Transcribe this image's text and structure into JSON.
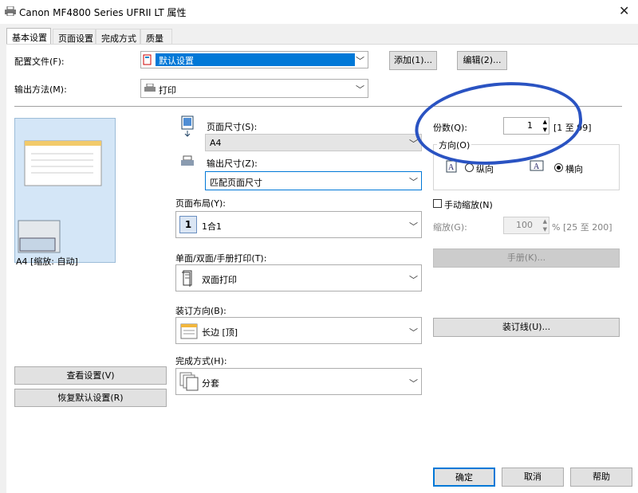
{
  "window": {
    "title": "Canon MF4800 Series UFRII LT 属性",
    "close": "✕"
  },
  "tabs": [
    "基本设置",
    "页面设置",
    "完成方式",
    "质量"
  ],
  "profile": {
    "label": "配置文件(F):",
    "value": "默认设置",
    "add": "添加(1)...",
    "edit": "编辑(2)..."
  },
  "output_method": {
    "label": "输出方法(M):",
    "value": "打印"
  },
  "preview": {
    "label": "A4 [缩放: 自动]"
  },
  "page_size": {
    "label": "页面尺寸(S):",
    "value": "A4"
  },
  "output_size": {
    "label": "输出尺寸(Z):",
    "value": "匹配页面尺寸"
  },
  "page_layout": {
    "label": "页面布局(Y):",
    "value": "1合1",
    "icon_num": "1"
  },
  "duplex": {
    "label": "单面/双面/手册打印(T):",
    "value": "双面打印"
  },
  "binding": {
    "label": "装订方向(B):",
    "value": "长边 [顶]"
  },
  "finishing": {
    "label": "完成方式(H):",
    "value": "分套"
  },
  "copies": {
    "label": "份数(Q):",
    "value": "1",
    "range": "[1 至 99]"
  },
  "orientation": {
    "label": "方向(O)",
    "portrait": "纵向",
    "landscape": "横向",
    "selected": "landscape"
  },
  "manual_scaling": {
    "label": "手动缩放(N)",
    "checked": false
  },
  "scaling": {
    "label": "缩放(G):",
    "value": "100",
    "range": "% [25 至 200]"
  },
  "buttons": {
    "booklet": "手册(K)...",
    "gutter": "装订线(U)...",
    "view_settings": "查看设置(V)",
    "restore_defaults": "恢复默认设置(R)",
    "ok": "确定",
    "cancel": "取消",
    "help": "帮助"
  },
  "colors": {
    "annotation": "#2a53c2",
    "selection": "#0078d7",
    "preview_bg": "#d4e6f7"
  }
}
